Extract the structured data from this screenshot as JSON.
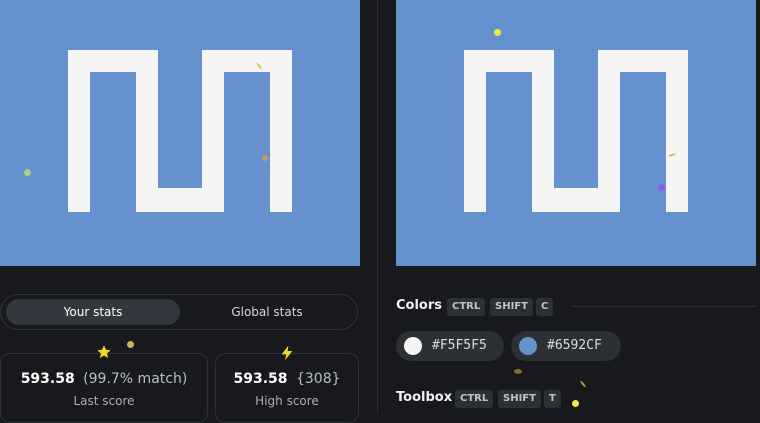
{
  "colors": {
    "background": "#6592CF",
    "foreground": "#F5F5F5"
  },
  "stats_tabs": {
    "active": "Your stats",
    "inactive": "Global stats"
  },
  "stats": {
    "last": {
      "icon": "star-icon",
      "value": "593.58",
      "detail": "(99.7% match)",
      "label": "Last score"
    },
    "high": {
      "icon": "lightning-icon",
      "value": "593.58",
      "detail": "{308}",
      "label": "High score"
    }
  },
  "colors_section": {
    "title": "Colors",
    "shortcut": [
      "CTRL",
      "SHIFT",
      "C"
    ],
    "swatches": [
      "#F5F5F5",
      "#6592CF"
    ]
  },
  "toolbox_section": {
    "title": "Toolbox",
    "shortcut": [
      "CTRL",
      "SHIFT",
      "T"
    ]
  }
}
